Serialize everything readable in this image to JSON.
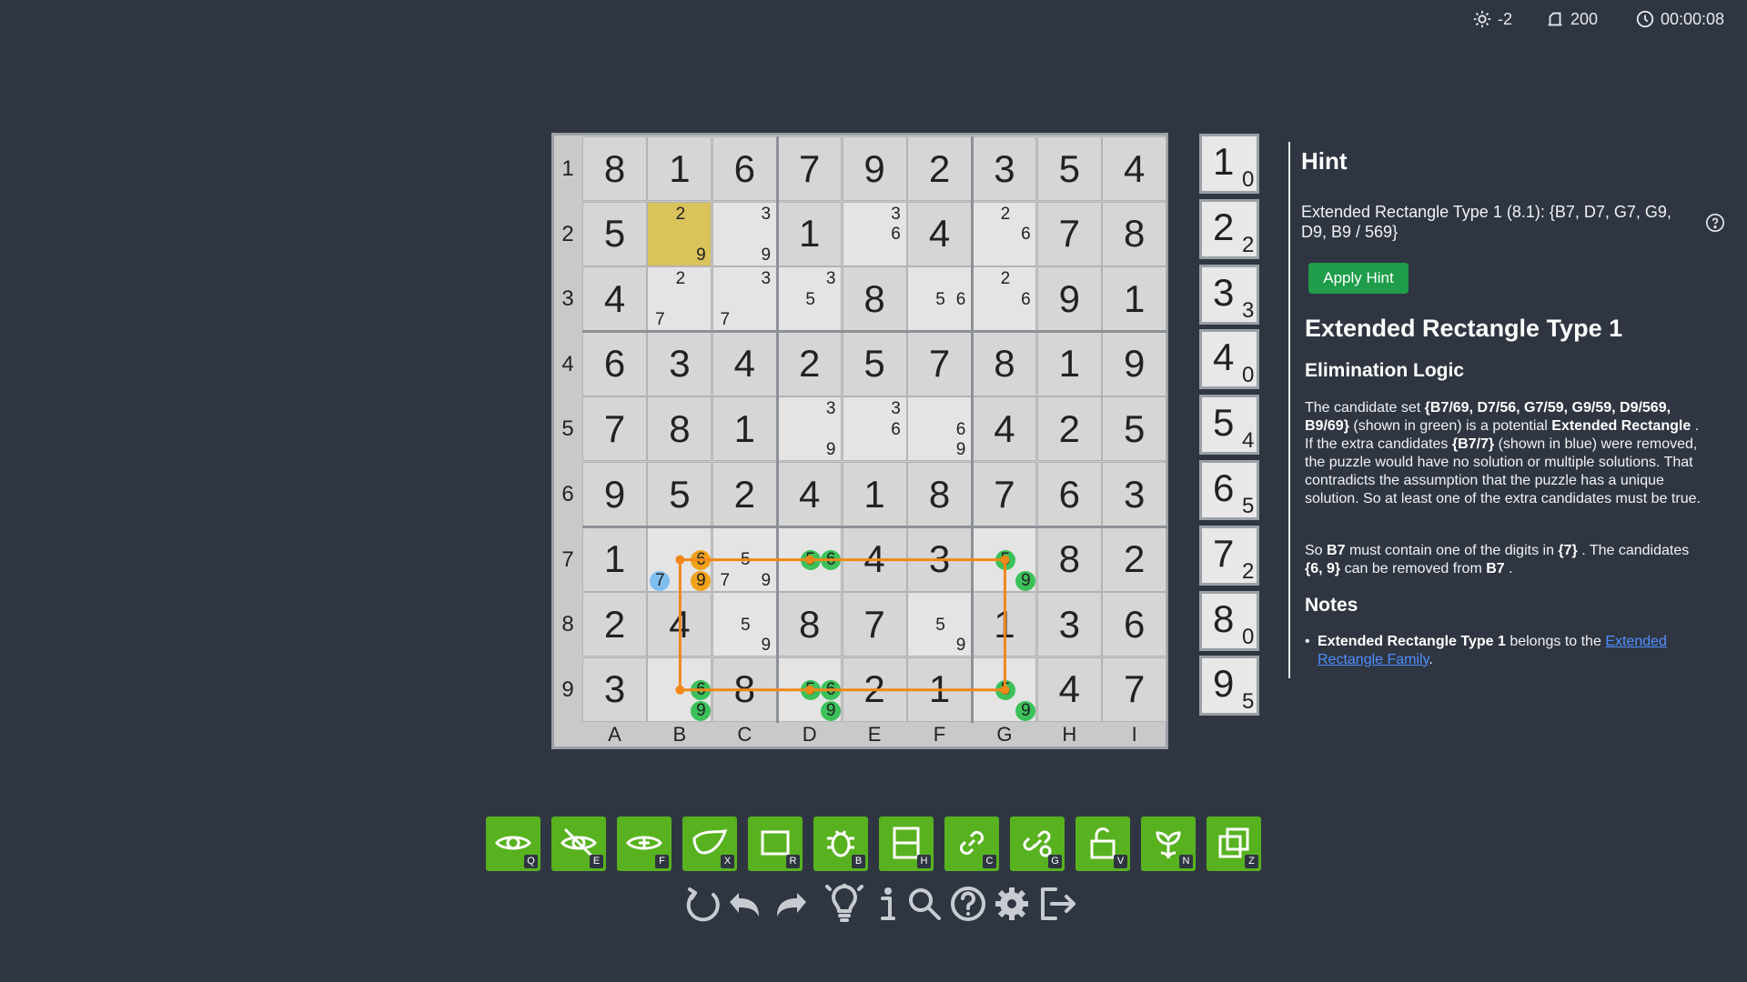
{
  "status": {
    "brightness_value": "-2",
    "score_value": "200",
    "timer_value": "00:00:08"
  },
  "board": {
    "row_labels": [
      "1",
      "2",
      "3",
      "4",
      "5",
      "6",
      "7",
      "8",
      "9"
    ],
    "col_labels": [
      "A",
      "B",
      "C",
      "D",
      "E",
      "F",
      "G",
      "H",
      "I"
    ],
    "values": [
      [
        "8",
        "1",
        "6",
        "7",
        "9",
        "2",
        "3",
        "5",
        "4"
      ],
      [
        "5",
        "",
        "",
        "1",
        "",
        "4",
        "",
        "7",
        "8"
      ],
      [
        "4",
        "",
        "",
        "",
        "8",
        "",
        "",
        "9",
        "1"
      ],
      [
        "6",
        "3",
        "4",
        "2",
        "5",
        "7",
        "8",
        "1",
        "9"
      ],
      [
        "7",
        "8",
        "1",
        "",
        "",
        "",
        "4",
        "2",
        "5"
      ],
      [
        "9",
        "5",
        "2",
        "4",
        "1",
        "8",
        "7",
        "6",
        "3"
      ],
      [
        "1",
        "",
        "",
        "",
        "4",
        "3",
        "",
        "8",
        "2"
      ],
      [
        "2",
        "4",
        "",
        "8",
        "7",
        "",
        "1",
        "3",
        "6"
      ],
      [
        "3",
        "",
        "8",
        "",
        "2",
        "1",
        "",
        "4",
        "7"
      ]
    ],
    "candidates": [
      {
        "cell": "B2",
        "digits": [
          "2",
          "9"
        ]
      },
      {
        "cell": "C2",
        "digits": [
          "3",
          "9"
        ]
      },
      {
        "cell": "E2",
        "digits": [
          "3",
          "6"
        ]
      },
      {
        "cell": "G2",
        "digits": [
          "2",
          "6"
        ]
      },
      {
        "cell": "B3",
        "digits": [
          "2",
          "7"
        ]
      },
      {
        "cell": "C3",
        "digits": [
          "3",
          "7"
        ]
      },
      {
        "cell": "D3",
        "digits": [
          "3",
          "5"
        ]
      },
      {
        "cell": "F3",
        "digits": [
          "5",
          "6"
        ]
      },
      {
        "cell": "G3",
        "digits": [
          "2",
          "6"
        ]
      },
      {
        "cell": "D5",
        "digits": [
          "3",
          "9"
        ]
      },
      {
        "cell": "E5",
        "digits": [
          "3",
          "6"
        ]
      },
      {
        "cell": "F5",
        "digits": [
          "6",
          "9"
        ]
      },
      {
        "cell": "B7",
        "digits": [
          "6",
          "7",
          "9"
        ]
      },
      {
        "cell": "C7",
        "digits": [
          "5",
          "7",
          "9"
        ]
      },
      {
        "cell": "D7",
        "digits": [
          "5",
          "6"
        ]
      },
      {
        "cell": "G7",
        "digits": [
          "5",
          "9"
        ]
      },
      {
        "cell": "C8",
        "digits": [
          "5",
          "9"
        ]
      },
      {
        "cell": "F8",
        "digits": [
          "5",
          "9"
        ]
      },
      {
        "cell": "B9",
        "digits": [
          "6",
          "9"
        ]
      },
      {
        "cell": "D9",
        "digits": [
          "5",
          "6",
          "9"
        ]
      },
      {
        "cell": "G9",
        "digits": [
          "5",
          "9"
        ]
      }
    ],
    "selected_cell": "B2",
    "highlight_colors": {
      "green": "#3cc15a",
      "orange": "#f1a21b",
      "blue": "#7fbff0",
      "selected": "#d9c35a",
      "link": "#f0881a"
    }
  },
  "digit_counter": [
    {
      "digit": "1",
      "count": "0"
    },
    {
      "digit": "2",
      "count": "2"
    },
    {
      "digit": "3",
      "count": "3"
    },
    {
      "digit": "4",
      "count": "0"
    },
    {
      "digit": "5",
      "count": "4"
    },
    {
      "digit": "6",
      "count": "5"
    },
    {
      "digit": "7",
      "count": "2"
    },
    {
      "digit": "8",
      "count": "0"
    },
    {
      "digit": "9",
      "count": "5"
    }
  ],
  "hint": {
    "panel_title": "Hint",
    "summary": "Extended Rectangle Type 1 (8.1): {B7, D7, G7, G9, D9, B9 / 569}",
    "apply_label": "Apply Hint",
    "technique_title": "Extended Rectangle Type 1",
    "logic_heading": "Elimination Logic",
    "logic_text_1": "The candidate set",
    "logic_set": "{B7/69, D7/56, G7/59, G9/59, D9/569, B9/69}",
    "logic_text_2": "(shown in green) is a potential",
    "logic_bold": "Extended Rectangle",
    "logic_text_3": ". If the extra candidates",
    "logic_extra": "{B7/7}",
    "logic_text_4": "(shown in blue) were removed, the puzzle would have no solution or multiple solutions. That contradicts the assumption that the puzzle has a unique solution. So at least one of the extra candidates must be true.",
    "so_text_1": "So",
    "so_cell": "B7",
    "so_text_2": "must contain one of the digits in",
    "so_digits": "{7}",
    "so_text_3": ". The candidates",
    "so_removed": "{6, 9}",
    "so_text_4": "can be removed from",
    "so_cell_2": "B7",
    "so_text_5": ".",
    "notes_heading": "Notes",
    "note_bold": "Extended Rectangle Type 1",
    "note_text": "belongs to the",
    "note_link": "Extended Rectangle Family",
    "note_end": "."
  },
  "toolbar": {
    "buttons": [
      {
        "icon": "eye-icon",
        "key": "Q"
      },
      {
        "icon": "eye-slash-icon",
        "key": "E"
      },
      {
        "icon": "fish-eye-icon",
        "key": "F"
      },
      {
        "icon": "wing-icon",
        "key": "X"
      },
      {
        "icon": "rectangle-icon",
        "key": "R"
      },
      {
        "icon": "bug-icon",
        "key": "B"
      },
      {
        "icon": "house-split-icon",
        "key": "H"
      },
      {
        "icon": "chain-icon",
        "key": "C"
      },
      {
        "icon": "grouped-chain-icon",
        "key": "G"
      },
      {
        "icon": "unlock-icon",
        "key": "V"
      },
      {
        "icon": "flower-icon",
        "key": "N"
      },
      {
        "icon": "copy-icon",
        "key": "Z"
      }
    ],
    "button_color": "#58b21f"
  },
  "controls": [
    "reset-icon",
    "undo-icon",
    "redo-icon",
    "hint-bulb-icon",
    "info-icon",
    "search-icon",
    "help-icon",
    "settings-icon",
    "exit-icon"
  ]
}
